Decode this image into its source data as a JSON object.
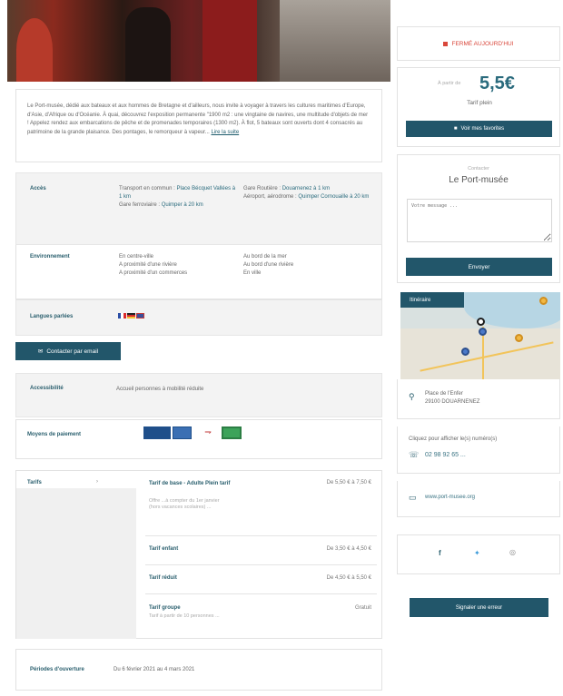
{
  "description": {
    "text": "Le Port-musée, dédié aux bateaux et aux hommes de Bretagne et d'ailleurs, nous invite à voyager à travers les cultures maritimes d'Europe, d'Asie, d'Afrique ou d'Océanie. À quai, découvrez l'exposition permanente \"1900 m2 : une vingtaine de navires, une multitude d'objets de mer ! Appelez rendez aux embarcations de pêche et de promenades temporaires (1300 m2). À flot, 5 bateaux sont ouverts dont 4 consacrés au patrimoine de la grande plaisance. Des pontages, le remorqueur à vapeur... ",
    "more": "Lire la suite"
  },
  "access": {
    "label": "Accès",
    "col1": [
      "Transport en commun :",
      "Place",
      "Bécquet Vallées à 1 km",
      "Gare ferroviaire :",
      "Quimper à 20 km"
    ],
    "col2": [
      "Gare Routière :",
      "Douarnenez à 1 km",
      "Aéroport, aérodrome :",
      "Quimper",
      "Cornouaille à 20 km"
    ]
  },
  "environment": {
    "label": "Environnement",
    "col1": [
      "En centre-ville",
      "A proximité d'une rivière",
      "A proximité d'un commerces"
    ],
    "col2": [
      "Au bord de la mer",
      "Au bord d'une rivière",
      "En ville"
    ]
  },
  "languages": {
    "label": "Langues parlées"
  },
  "contact_email_btn": "Contacter par email",
  "accessibility": {
    "label": "Accessibilité",
    "value": "Accueil personnes à mobilité réduite"
  },
  "payment": {
    "label": "Moyens de paiement"
  },
  "tarifs": {
    "label": "Tarifs",
    "rows": [
      {
        "name": "Tarif de base - Adulte Plein tarif",
        "price": "De 5,50 € à 7,50 €",
        "sub": "Offre ...à compter du 1er janvier (hors vacances scolaires) ..."
      },
      {
        "name": "Tarif enfant",
        "price": "De 3,50 € à 4,50 €",
        "sub": ""
      },
      {
        "name": "Tarif réduit",
        "price": "De 4,50 € à 5,50 €",
        "sub": ""
      },
      {
        "name": "Tarif groupe",
        "price": "Gratuit",
        "sub": "Tarif à partir de 10 personnes ..."
      }
    ]
  },
  "periods": {
    "label": "Périodes d'ouverture",
    "value": "Du 6 février 2021 au 4 mars 2021"
  },
  "sidebar": {
    "closed": "FERMÉ AUJOURD'HUI",
    "price_from": "À partir de",
    "price": "5,5€",
    "price_label": "Tarif plein",
    "favorites_btn": "Voir mes favorites",
    "contact_small": "Contacter",
    "contact_name": "Le Port-musée",
    "message_placeholder": "Votre message ...",
    "send_btn": "Envoyer",
    "map_tag": "Itinéraire",
    "address": [
      "Place de l'Enfer",
      "29100 DOUARNENEZ"
    ],
    "phone_hint": "Cliquez pour afficher le(s) numéro(s)",
    "phone": "02 98 92 65 ...",
    "website": "www.port-musee.org",
    "report_btn": "Signaler une erreur"
  }
}
